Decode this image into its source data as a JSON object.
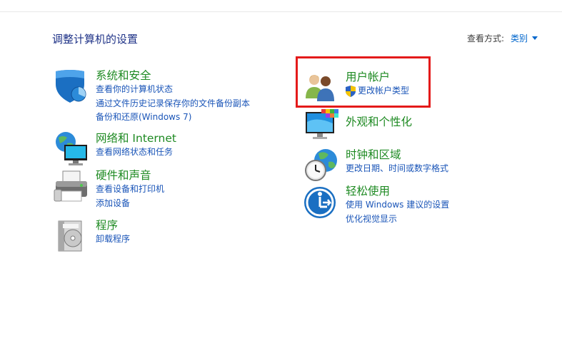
{
  "header": {
    "title": "调整计算机的设置",
    "view_by_label": "查看方式:",
    "view_by_value": "类别"
  },
  "categories_left": [
    {
      "title": "系统和安全",
      "links": [
        "查看你的计算机状态",
        "通过文件历史记录保存你的文件备份副本",
        "备份和还原(Windows 7)"
      ]
    },
    {
      "title": "网络和 Internet",
      "links": [
        "查看网络状态和任务"
      ]
    },
    {
      "title": "硬件和声音",
      "links": [
        "查看设备和打印机",
        "添加设备"
      ]
    },
    {
      "title": "程序",
      "links": [
        "卸载程序"
      ]
    }
  ],
  "categories_right": [
    {
      "title": "用户帐户",
      "links": [
        "更改帐户类型"
      ]
    },
    {
      "title": "外观和个性化",
      "links": []
    },
    {
      "title": "时钟和区域",
      "links": [
        "更改日期、时间或数字格式"
      ]
    },
    {
      "title": "轻松使用",
      "links": [
        "使用 Windows 建议的设置",
        "优化视觉显示"
      ]
    }
  ],
  "colors": {
    "title_green": "#1e8a22",
    "link_blue": "#1a55b8",
    "highlight_red": "#e41a1a"
  }
}
